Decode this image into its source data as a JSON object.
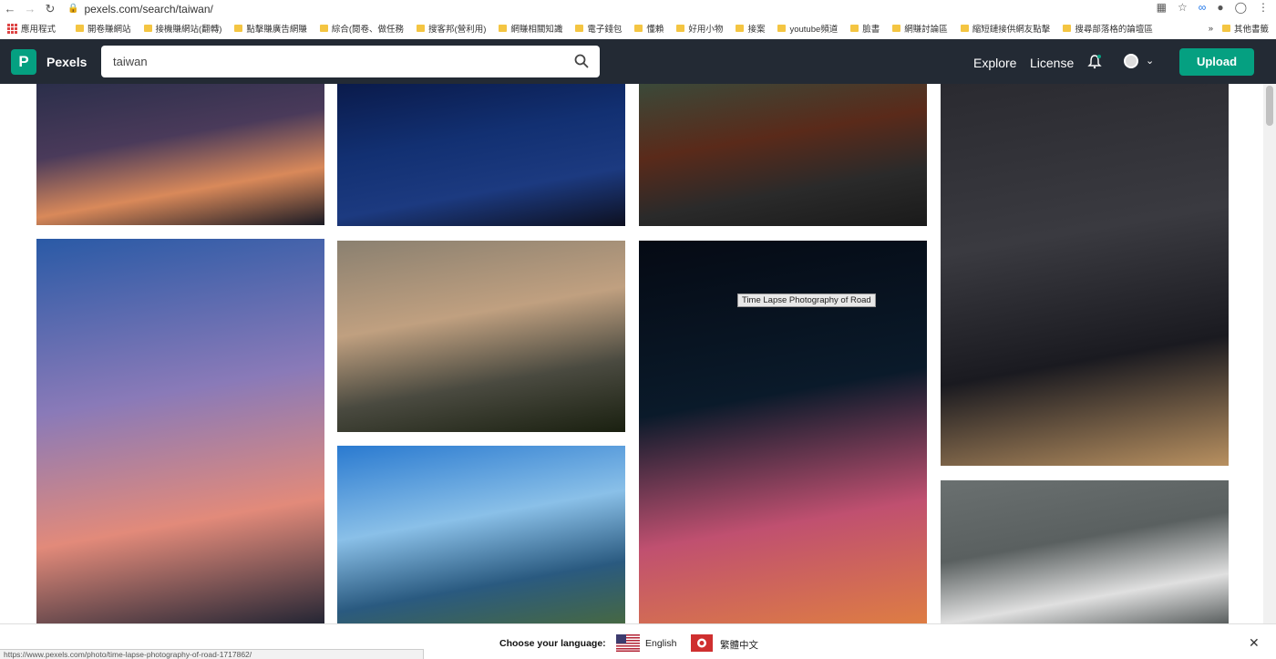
{
  "browser": {
    "url": "pexels.com/search/taiwan/",
    "bookmarks": [
      "應用程式",
      "開卷賺網站",
      "接機賺網站(翻轉)",
      "點擊賺廣告網賺",
      "綜合(閱卷、做任務",
      "搜客邦(營利用)",
      "網賺相關知識",
      "電子錢包",
      "懂賴",
      "好用小物",
      "接案",
      "youtube頻道",
      "臉書",
      "網賺討論區",
      "縮短鏈接供網友點擊",
      "搜尋部落格的論壇區"
    ],
    "more_bookmarks": "其他書籤",
    "status_url": "https://www.pexels.com/photo/time-lapse-photography-of-road-1717862/"
  },
  "header": {
    "brand": "Pexels",
    "logo_letter": "P",
    "search_value": "taiwan",
    "explore": "Explore",
    "license": "License",
    "upload": "Upload"
  },
  "gallery": {
    "tooltip": "Time Lapse Photography of Road",
    "photos": [
      {
        "name": "photo-taipei-sunset-skyline",
        "colors": [
          "#2a2e4a",
          "#4a3a5a",
          "#d9895a",
          "#1a1a24"
        ]
      },
      {
        "name": "photo-taipei-101-night-blue",
        "colors": [
          "#0a1a4a",
          "#123072",
          "#1c3a80",
          "#0d1020"
        ]
      },
      {
        "name": "photo-jiufen-teahouse",
        "colors": [
          "#3a4a3a",
          "#5a2a1a",
          "#2a2a2a",
          "#1a1a1a"
        ]
      },
      {
        "name": "photo-street-food-stall",
        "colors": [
          "#2a2a30",
          "#3a3a40",
          "#1a1a20",
          "#b89060"
        ]
      },
      {
        "name": "photo-taipei-101-dusk",
        "colors": [
          "#2a5aa6",
          "#8a7ab8",
          "#e28a7a",
          "#1a2030"
        ]
      },
      {
        "name": "photo-hazy-sunset-city",
        "colors": [
          "#8a8070",
          "#c0a080",
          "#4a4a40",
          "#1a2010"
        ]
      },
      {
        "name": "photo-light-trails-taipei-101",
        "colors": [
          "#050a14",
          "#0a1a2a",
          "#c05070",
          "#e08040"
        ]
      },
      {
        "name": "photo-crosswalk-pedestrians",
        "colors": [
          "#6a7070",
          "#5a6060",
          "#e0e0e0",
          "#3a4040"
        ]
      },
      {
        "name": "photo-mountain-blue-sky",
        "colors": [
          "#2a7ad0",
          "#8ac0e8",
          "#2a5a80",
          "#4a6a3a"
        ]
      }
    ]
  },
  "language_bar": {
    "label": "Choose your language:",
    "english": "English",
    "chinese": "繁體中文"
  }
}
